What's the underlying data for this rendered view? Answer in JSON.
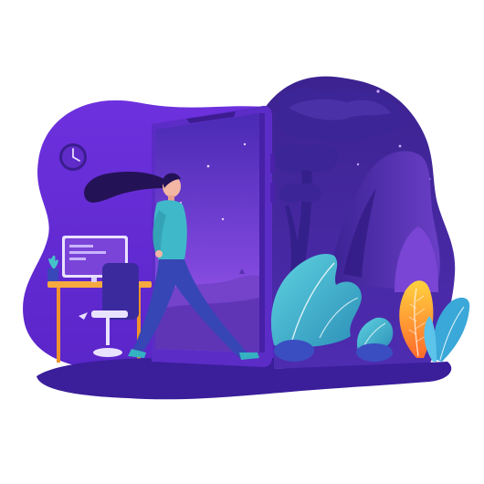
{
  "illustration": {
    "subject": "woman-stepping-through-phone-portal",
    "icons": [
      "wall-clock-icon",
      "desktop-monitor-icon",
      "potted-plant-icon",
      "office-chair-icon",
      "smartphone-portal-icon",
      "tree-icon",
      "leaf-plant-icon"
    ],
    "colors": {
      "background": "#ffffff",
      "room_purple": "#6a2fd6",
      "deep_purple": "#3f1e9b",
      "night_purple": "#4a2aa8",
      "phone_frame": "#5b2bc4",
      "screen_top": "#4d2bb8",
      "screen_bottom": "#9a59e6",
      "teal": "#3fb8c9",
      "denim": "#3848b8",
      "desk_orange": "#f4a23c",
      "leaf_yellow": "#ffc83a",
      "leaf_orange": "#ff7a2c"
    }
  }
}
